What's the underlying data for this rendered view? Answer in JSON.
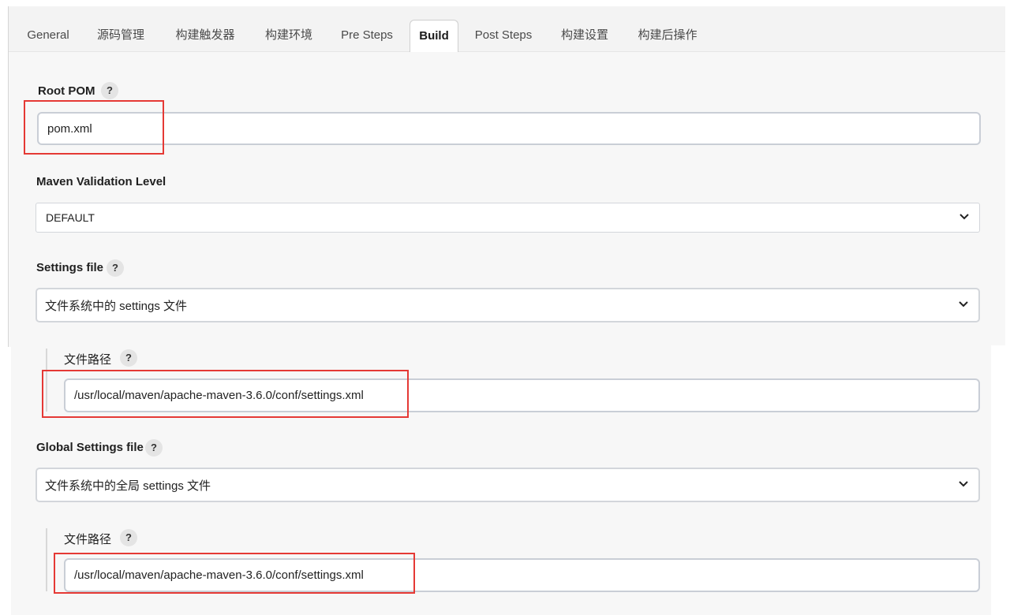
{
  "tabs": [
    {
      "label": "General"
    },
    {
      "label": "源码管理"
    },
    {
      "label": "构建触发器"
    },
    {
      "label": "构建环境"
    },
    {
      "label": "Pre Steps"
    },
    {
      "label": "Build"
    },
    {
      "label": "Post Steps"
    },
    {
      "label": "构建设置"
    },
    {
      "label": "构建后操作"
    }
  ],
  "active_tab": "Build",
  "help_symbol": "?",
  "root_pom": {
    "label": "Root POM",
    "value": "pom.xml"
  },
  "maven_validation": {
    "label": "Maven Validation Level",
    "selected": "DEFAULT"
  },
  "settings_file": {
    "label": "Settings file",
    "selected": "文件系统中的 settings 文件",
    "path_label": "文件路径",
    "path_value": "/usr/local/maven/apache-maven-3.6.0/conf/settings.xml"
  },
  "global_settings_file": {
    "label": "Global Settings file",
    "selected": "文件系统中的全局 settings 文件",
    "path_label": "文件路径",
    "path_value": "/usr/local/maven/apache-maven-3.6.0/conf/settings.xml"
  },
  "colors": {
    "highlight": "#e53935",
    "panel_bg": "#f7f7f7",
    "tabbar_bg": "#f3f3f3"
  }
}
